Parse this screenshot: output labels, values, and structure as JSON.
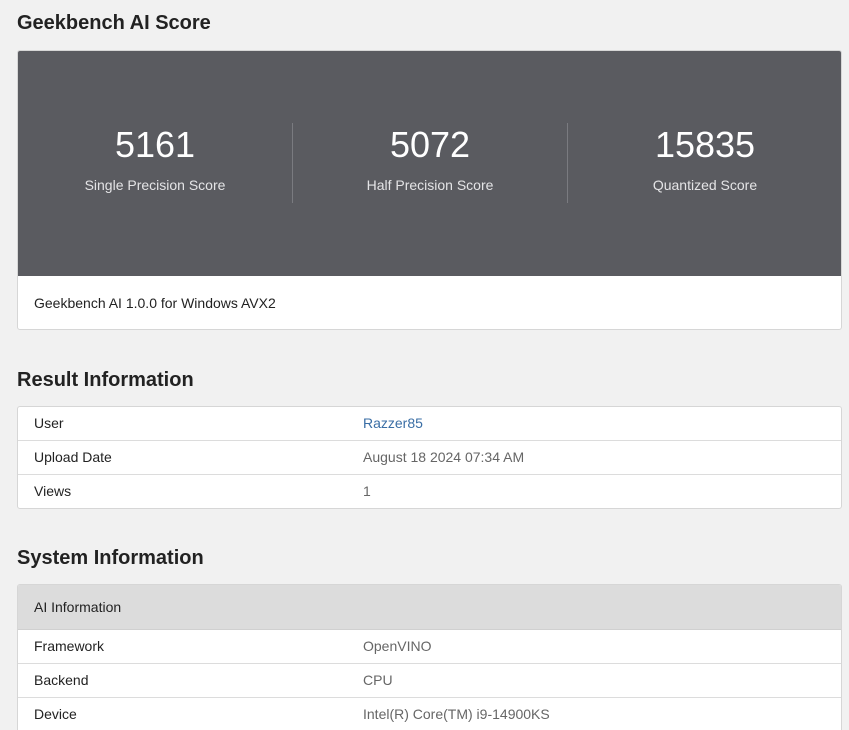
{
  "score_section": {
    "title": "Geekbench AI Score",
    "scores": [
      {
        "value": "5161",
        "label": "Single Precision Score"
      },
      {
        "value": "5072",
        "label": "Half Precision Score"
      },
      {
        "value": "15835",
        "label": "Quantized Score"
      }
    ],
    "version": "Geekbench AI 1.0.0 for Windows AVX2"
  },
  "result_section": {
    "title": "Result Information",
    "rows": [
      {
        "key": "User",
        "value": "Razzer85"
      },
      {
        "key": "Upload Date",
        "value": "August 18 2024 07:34 AM"
      },
      {
        "key": "Views",
        "value": "1"
      }
    ]
  },
  "system_section": {
    "title": "System Information",
    "header": "AI Information",
    "rows": [
      {
        "key": "Framework",
        "value": "OpenVINO"
      },
      {
        "key": "Backend",
        "value": "CPU"
      },
      {
        "key": "Device",
        "value": "Intel(R) Core(TM) i9-14900KS"
      }
    ]
  },
  "colors": {
    "score_panel": "#5a5b60",
    "link": "#3a6ea5",
    "background": "#f1f1f1"
  }
}
